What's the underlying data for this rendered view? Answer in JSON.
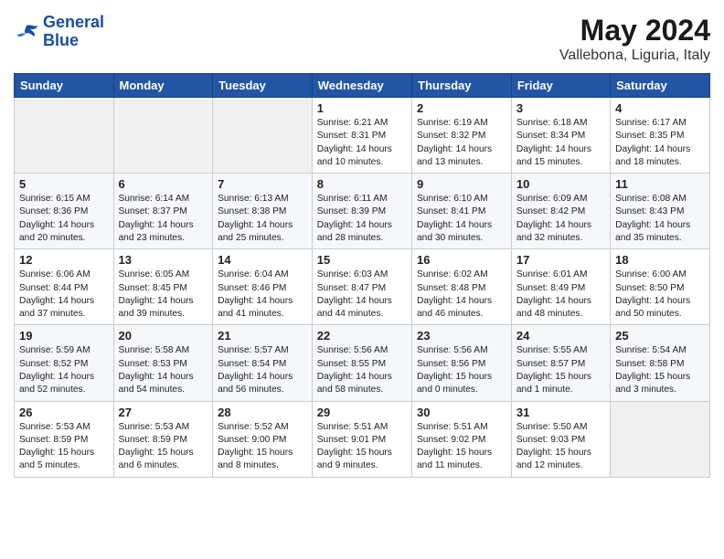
{
  "header": {
    "logo_line1": "General",
    "logo_line2": "Blue",
    "month_year": "May 2024",
    "location": "Vallebona, Liguria, Italy"
  },
  "weekdays": [
    "Sunday",
    "Monday",
    "Tuesday",
    "Wednesday",
    "Thursday",
    "Friday",
    "Saturday"
  ],
  "weeks": [
    [
      {
        "day": "",
        "info": ""
      },
      {
        "day": "",
        "info": ""
      },
      {
        "day": "",
        "info": ""
      },
      {
        "day": "1",
        "info": "Sunrise: 6:21 AM\nSunset: 8:31 PM\nDaylight: 14 hours\nand 10 minutes."
      },
      {
        "day": "2",
        "info": "Sunrise: 6:19 AM\nSunset: 8:32 PM\nDaylight: 14 hours\nand 13 minutes."
      },
      {
        "day": "3",
        "info": "Sunrise: 6:18 AM\nSunset: 8:34 PM\nDaylight: 14 hours\nand 15 minutes."
      },
      {
        "day": "4",
        "info": "Sunrise: 6:17 AM\nSunset: 8:35 PM\nDaylight: 14 hours\nand 18 minutes."
      }
    ],
    [
      {
        "day": "5",
        "info": "Sunrise: 6:15 AM\nSunset: 8:36 PM\nDaylight: 14 hours\nand 20 minutes."
      },
      {
        "day": "6",
        "info": "Sunrise: 6:14 AM\nSunset: 8:37 PM\nDaylight: 14 hours\nand 23 minutes."
      },
      {
        "day": "7",
        "info": "Sunrise: 6:13 AM\nSunset: 8:38 PM\nDaylight: 14 hours\nand 25 minutes."
      },
      {
        "day": "8",
        "info": "Sunrise: 6:11 AM\nSunset: 8:39 PM\nDaylight: 14 hours\nand 28 minutes."
      },
      {
        "day": "9",
        "info": "Sunrise: 6:10 AM\nSunset: 8:41 PM\nDaylight: 14 hours\nand 30 minutes."
      },
      {
        "day": "10",
        "info": "Sunrise: 6:09 AM\nSunset: 8:42 PM\nDaylight: 14 hours\nand 32 minutes."
      },
      {
        "day": "11",
        "info": "Sunrise: 6:08 AM\nSunset: 8:43 PM\nDaylight: 14 hours\nand 35 minutes."
      }
    ],
    [
      {
        "day": "12",
        "info": "Sunrise: 6:06 AM\nSunset: 8:44 PM\nDaylight: 14 hours\nand 37 minutes."
      },
      {
        "day": "13",
        "info": "Sunrise: 6:05 AM\nSunset: 8:45 PM\nDaylight: 14 hours\nand 39 minutes."
      },
      {
        "day": "14",
        "info": "Sunrise: 6:04 AM\nSunset: 8:46 PM\nDaylight: 14 hours\nand 41 minutes."
      },
      {
        "day": "15",
        "info": "Sunrise: 6:03 AM\nSunset: 8:47 PM\nDaylight: 14 hours\nand 44 minutes."
      },
      {
        "day": "16",
        "info": "Sunrise: 6:02 AM\nSunset: 8:48 PM\nDaylight: 14 hours\nand 46 minutes."
      },
      {
        "day": "17",
        "info": "Sunrise: 6:01 AM\nSunset: 8:49 PM\nDaylight: 14 hours\nand 48 minutes."
      },
      {
        "day": "18",
        "info": "Sunrise: 6:00 AM\nSunset: 8:50 PM\nDaylight: 14 hours\nand 50 minutes."
      }
    ],
    [
      {
        "day": "19",
        "info": "Sunrise: 5:59 AM\nSunset: 8:52 PM\nDaylight: 14 hours\nand 52 minutes."
      },
      {
        "day": "20",
        "info": "Sunrise: 5:58 AM\nSunset: 8:53 PM\nDaylight: 14 hours\nand 54 minutes."
      },
      {
        "day": "21",
        "info": "Sunrise: 5:57 AM\nSunset: 8:54 PM\nDaylight: 14 hours\nand 56 minutes."
      },
      {
        "day": "22",
        "info": "Sunrise: 5:56 AM\nSunset: 8:55 PM\nDaylight: 14 hours\nand 58 minutes."
      },
      {
        "day": "23",
        "info": "Sunrise: 5:56 AM\nSunset: 8:56 PM\nDaylight: 15 hours\nand 0 minutes."
      },
      {
        "day": "24",
        "info": "Sunrise: 5:55 AM\nSunset: 8:57 PM\nDaylight: 15 hours\nand 1 minute."
      },
      {
        "day": "25",
        "info": "Sunrise: 5:54 AM\nSunset: 8:58 PM\nDaylight: 15 hours\nand 3 minutes."
      }
    ],
    [
      {
        "day": "26",
        "info": "Sunrise: 5:53 AM\nSunset: 8:59 PM\nDaylight: 15 hours\nand 5 minutes."
      },
      {
        "day": "27",
        "info": "Sunrise: 5:53 AM\nSunset: 8:59 PM\nDaylight: 15 hours\nand 6 minutes."
      },
      {
        "day": "28",
        "info": "Sunrise: 5:52 AM\nSunset: 9:00 PM\nDaylight: 15 hours\nand 8 minutes."
      },
      {
        "day": "29",
        "info": "Sunrise: 5:51 AM\nSunset: 9:01 PM\nDaylight: 15 hours\nand 9 minutes."
      },
      {
        "day": "30",
        "info": "Sunrise: 5:51 AM\nSunset: 9:02 PM\nDaylight: 15 hours\nand 11 minutes."
      },
      {
        "day": "31",
        "info": "Sunrise: 5:50 AM\nSunset: 9:03 PM\nDaylight: 15 hours\nand 12 minutes."
      },
      {
        "day": "",
        "info": ""
      }
    ]
  ]
}
